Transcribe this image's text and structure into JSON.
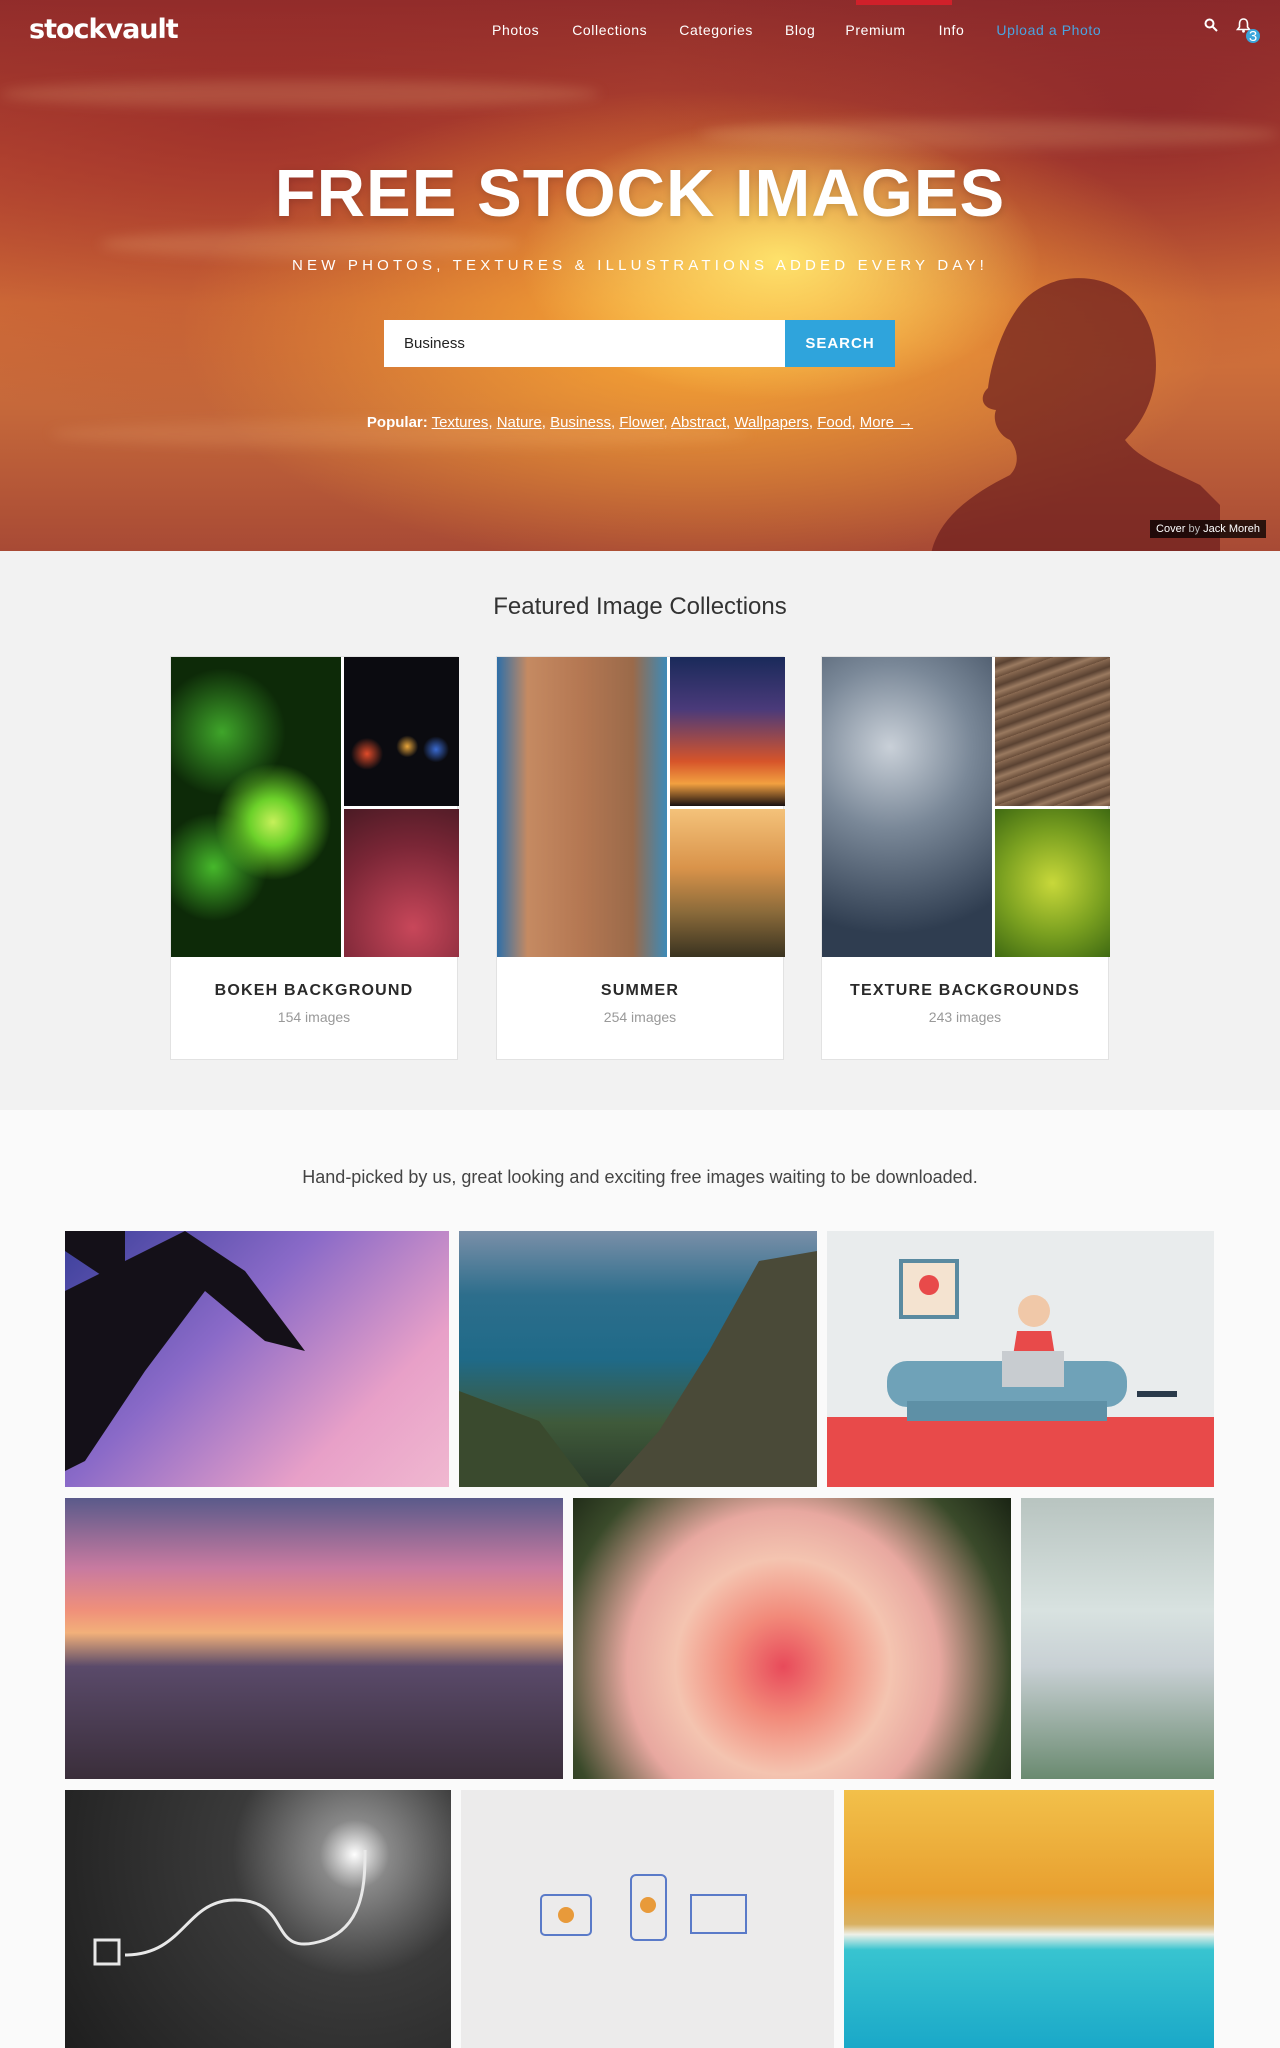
{
  "nav": {
    "logo": "stockvault",
    "links": [
      "Photos",
      "Collections",
      "Categories",
      "Blog",
      "Premium",
      "Info",
      "Upload a Photo"
    ],
    "notification_count": "3"
  },
  "hero": {
    "title": "FREE STOCK IMAGES",
    "subtitle": "NEW PHOTOS, TEXTURES & ILLUSTRATIONS ADDED EVERY DAY!",
    "search_value": "Business",
    "search_button": "SEARCH",
    "popular_label": "Popular:",
    "popular_links": [
      "Textures",
      "Nature",
      "Business",
      "Flower",
      "Abstract",
      "Wallpapers",
      "Food",
      "More →"
    ],
    "credit_prefix": "Cover",
    "credit_by": "by",
    "credit_name": "Jack Moreh"
  },
  "featured": {
    "heading": "Featured Image Collections",
    "collections": [
      {
        "name": "BOKEH BACKGROUND",
        "count": "154 images"
      },
      {
        "name": "SUMMER",
        "count": "254 images"
      },
      {
        "name": "TEXTURE BACKGROUNDS",
        "count": "243 images"
      }
    ]
  },
  "gallery": {
    "intro": "Hand-picked by us, great looking and exciting free images waiting to be downloaded."
  },
  "colors": {
    "accent": "#2fa4dc",
    "premium_bar": "#d0202a",
    "upload_link": "#4aa3e0"
  }
}
